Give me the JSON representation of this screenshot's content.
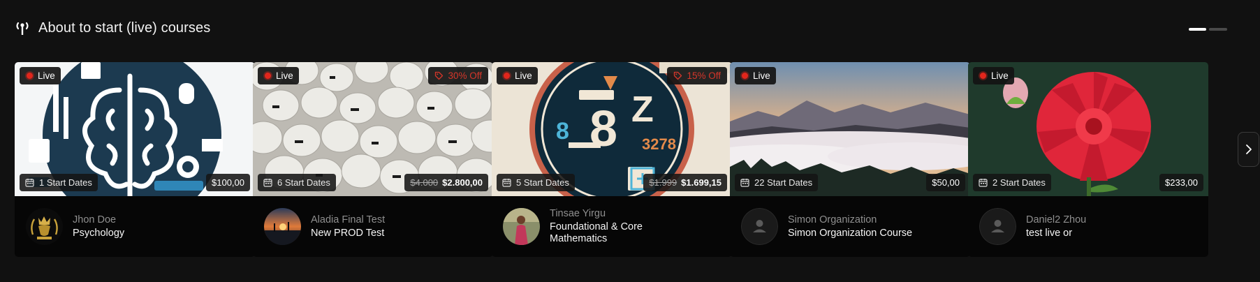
{
  "header": {
    "icon": "antenna-icon",
    "title": "About to start (live) courses"
  },
  "pager": {
    "pages": 2,
    "active": 1
  },
  "colors": {
    "background": "#111111",
    "card": "#060606",
    "live_dot": "#e1261c",
    "discount": "#d5362a"
  },
  "cards": [
    {
      "live_label": "Live",
      "start_dates": "1 Start Dates",
      "price": "$100,00",
      "author": "Jhon Doe",
      "course": "Psychology",
      "image": "brain-illustration",
      "avatar": "gold-lion-logo"
    },
    {
      "live_label": "Live",
      "discount": "30% Off",
      "start_dates": "6 Start Dates",
      "old_price": "$4.000",
      "price": "$2.800,00",
      "author": "Aladia Final Test",
      "course": "New PROD Test",
      "image": "paper-lanterns-photo",
      "avatar": "sunset-photo"
    },
    {
      "live_label": "Live",
      "discount": "15% Off",
      "start_dates": "5 Start Dates",
      "old_price": "$1.999",
      "price": "$1.699,15",
      "author": "Tinsae Yirgu",
      "course_line1": "Foundational & Core",
      "course_line2": "Mathematics",
      "image": "math-symbols-illustration",
      "avatar": "person-photo"
    },
    {
      "live_label": "Live",
      "start_dates": "22 Start Dates",
      "price": "$50,00",
      "author": "Simon Organization",
      "course": "Simon Organization Course",
      "image": "misty-valley-photo",
      "avatar": "default-user-icon"
    },
    {
      "live_label": "Live",
      "start_dates": "2 Start Dates",
      "price": "$233,00",
      "author": "Daniel2 Zhou",
      "course": "test live or",
      "image": "red-dahlia-photo",
      "avatar": "default-user-icon"
    }
  ],
  "next_button_icon": "chevron-right-icon",
  "badge_icons": {
    "calendar": "calendar-icon",
    "tag": "tag-icon",
    "live": "live-dot-icon"
  }
}
